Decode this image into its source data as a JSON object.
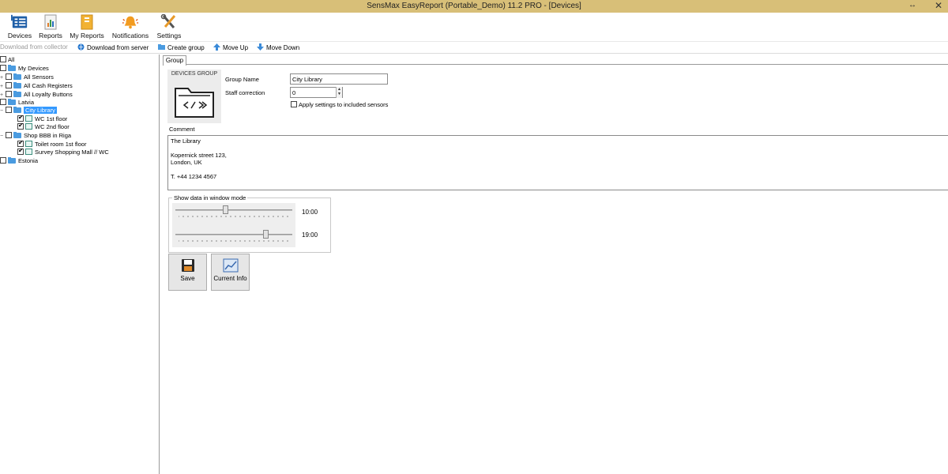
{
  "window": {
    "title": "SensMax EasyReport (Portable_Demo) 11.2 PRO - [Devices]",
    "resize_glyph": "↔",
    "close_glyph": "✕"
  },
  "ribbon": {
    "devices": "Devices",
    "reports": "Reports",
    "my_reports": "My Reports",
    "notifications": "Notifications",
    "settings": "Settings"
  },
  "toolbar": {
    "download_collector": "Download from collector",
    "download_server": "Download from server",
    "create_group": "Create group",
    "move_up": "Move Up",
    "move_down": "Move Down"
  },
  "tree": {
    "all": "All",
    "my_devices": "My Devices",
    "all_sensors": "All Sensors",
    "all_cash_registers": "All Cash Registers",
    "all_loyalty_buttons": "All Loyalty Buttons",
    "latvia": "Latvia",
    "city_library": "City Library",
    "wc_1st_floor": "WC 1st floor",
    "wc_2nd_floor": "WC 2nd floor",
    "shop_bbb": "Shop BBB in Riga",
    "toilet_room": "Toilet room 1st floor",
    "survey_mall": "Survey Shopping Mall // WC",
    "estonia": "Estonia"
  },
  "main": {
    "tab_group": "Group",
    "devices_group_label": "DEVICES GROUP",
    "group_name_label": "Group Name",
    "group_name_value": "City Library",
    "staff_correction_label": "Staff correction",
    "staff_correction_value": "0",
    "apply_settings_label": "Apply settings to included sensors",
    "comment_label": "Comment",
    "comment_lines": [
      "The Library",
      "",
      "Kopernick street 123,",
      "London, UK",
      "",
      "T. +44 1234 4567"
    ],
    "window_mode_label": "Show data in window mode",
    "time_start": "10:00",
    "time_end": "19:00",
    "save_label": "Save",
    "current_info_label": "Current Info"
  },
  "colors": {
    "titlebar": "#d8bf78",
    "selection": "#3399ff",
    "folder": "#4a9be0"
  }
}
